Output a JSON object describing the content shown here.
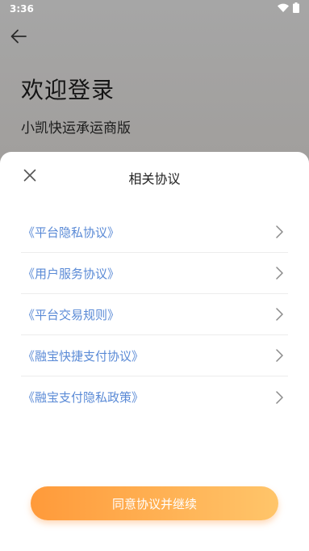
{
  "status_bar": {
    "time": "3:36"
  },
  "page": {
    "welcome_title": "欢迎登录",
    "welcome_subtitle": "小凯快运承运商版"
  },
  "sheet": {
    "title": "相关协议",
    "agreements": [
      {
        "label": "《平台隐私协议》"
      },
      {
        "label": "《用户服务协议》"
      },
      {
        "label": "《平台交易规则》"
      },
      {
        "label": "《融宝快捷支付协议》"
      },
      {
        "label": "《融宝支付隐私政策》"
      }
    ],
    "agree_button_label": "同意协议并继续"
  },
  "colors": {
    "link": "#5a8ad6",
    "accent_start": "#ff9a3a",
    "accent_end": "#ffc56a"
  },
  "icons": {
    "back": "arrow-left-icon",
    "close": "close-icon",
    "row": "chevron-right-icon",
    "wifi": "wifi-icon",
    "battery": "battery-icon"
  }
}
